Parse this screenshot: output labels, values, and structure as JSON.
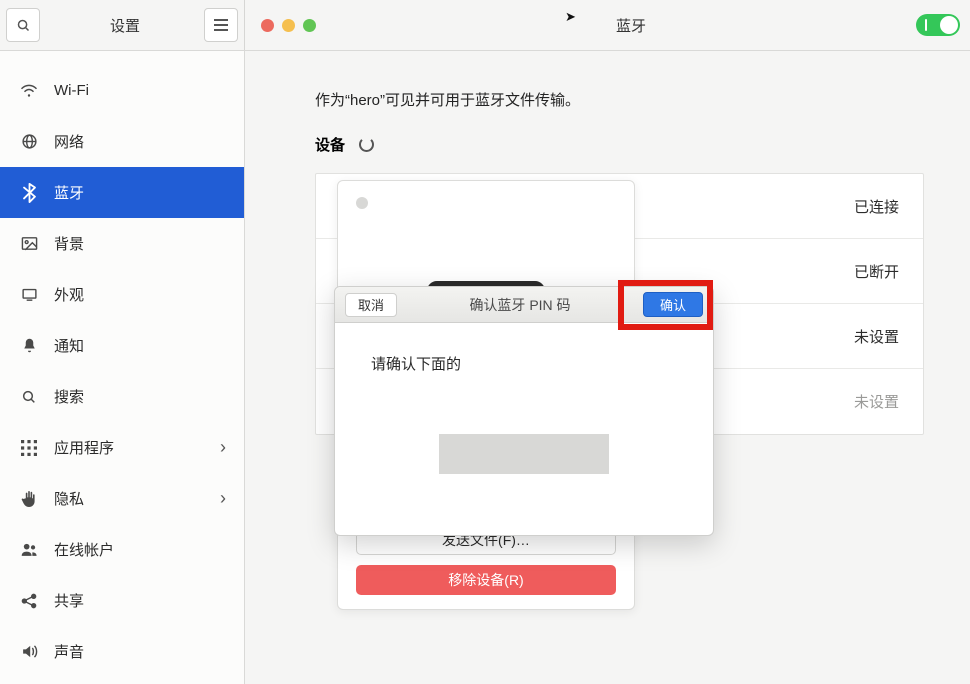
{
  "header": {
    "settings_title": "设置",
    "page_title": "蓝牙"
  },
  "sidebar": {
    "items": [
      {
        "icon": "wifi",
        "label": "Wi-Fi"
      },
      {
        "icon": "globe",
        "label": "网络"
      },
      {
        "icon": "bluetooth",
        "label": "蓝牙"
      },
      {
        "icon": "image",
        "label": "背景"
      },
      {
        "icon": "display",
        "label": "外观"
      },
      {
        "icon": "bell",
        "label": "通知"
      },
      {
        "icon": "search",
        "label": "搜索"
      },
      {
        "icon": "apps",
        "label": "应用程序",
        "expandable": true
      },
      {
        "icon": "hand",
        "label": "隐私",
        "expandable": true
      },
      {
        "icon": "accounts",
        "label": "在线帐户"
      },
      {
        "icon": "share",
        "label": "共享"
      },
      {
        "icon": "volume",
        "label": "声音"
      }
    ],
    "active_index": 2
  },
  "content": {
    "visible_line": "作为“hero”可见并可用于蓝牙文件传输。",
    "devices_header": "设备",
    "device_statuses": [
      "已连接",
      "已断开",
      "未设置",
      "未设置"
    ]
  },
  "popover": {
    "send_label": "发送文件(F)…",
    "remove_label": "移除设备(R)"
  },
  "dialog": {
    "cancel_label": "取消",
    "title": "确认蓝牙 PIN 码",
    "confirm_label": "确认",
    "body_text": "请确认下面的"
  }
}
